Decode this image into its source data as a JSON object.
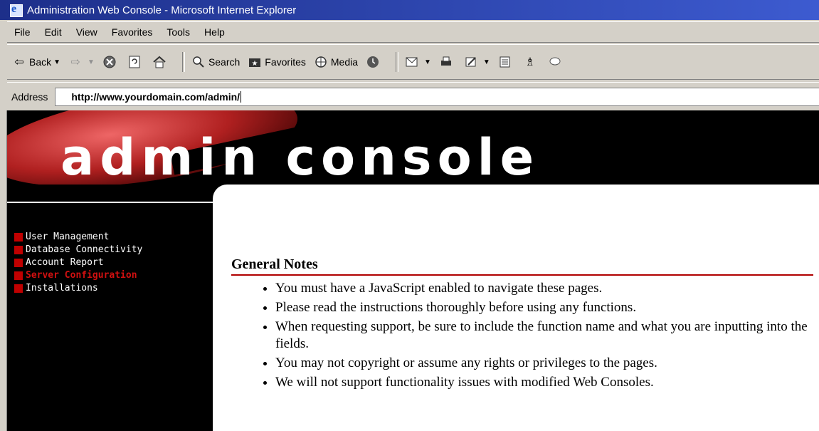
{
  "window": {
    "title": "Administration Web Console - Microsoft Internet Explorer"
  },
  "menubar": {
    "items": [
      "File",
      "Edit",
      "View",
      "Favorites",
      "Tools",
      "Help"
    ]
  },
  "toolbar": {
    "back_label": "Back",
    "search_label": "Search",
    "favorites_label": "Favorites",
    "media_label": "Media"
  },
  "address": {
    "label": "Address",
    "url": "http://www.yourdomain.com/admin/"
  },
  "banner": {
    "logo_text": "admin console"
  },
  "sidebar": {
    "items": [
      {
        "label": "User Management",
        "active": false
      },
      {
        "label": "Database Connectivity",
        "active": false
      },
      {
        "label": "Account Report",
        "active": false
      },
      {
        "label": "Server Configuration",
        "active": true
      },
      {
        "label": "Installations",
        "active": false
      }
    ]
  },
  "content": {
    "title": "General Notes",
    "notes": [
      "You must have a JavaScript enabled to navigate these pages.",
      "Please read the instructions thoroughly before using any functions.",
      "When requesting support, be sure to include the function name and what you are inputting into the fields.",
      "You may not copyright or assume any rights or privileges to the pages.",
      "We will not support functionality issues with modified Web Consoles."
    ]
  },
  "colors": {
    "accent_red": "#c00000",
    "titlebar": "#1d2f8a",
    "chrome": "#d4d0c8"
  }
}
